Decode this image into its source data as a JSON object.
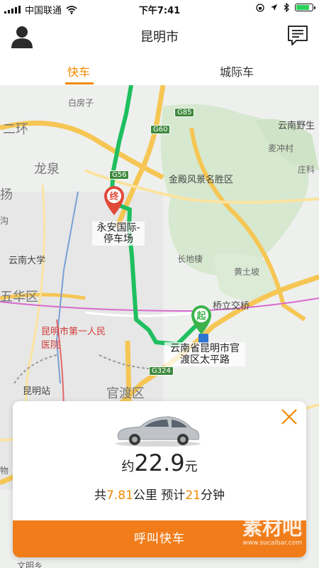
{
  "status_bar": {
    "carrier": "中国联通",
    "time": "下午7:41",
    "battery_level": 0.9,
    "icons": [
      "signal-icon",
      "wifi-icon",
      "lock-rotation-icon",
      "location-arrow-icon",
      "bluetooth-icon",
      "battery-icon"
    ]
  },
  "header": {
    "title": "昆明市",
    "left_icon": "user-avatar-icon",
    "right_icon": "message-icon"
  },
  "tabs": [
    {
      "label": "快车",
      "active": true
    },
    {
      "label": "城际车",
      "active": false
    }
  ],
  "map": {
    "labels": {
      "baifangzi": "白房子",
      "erhuan": "二环",
      "longquan": "龙泉",
      "yang": "扬",
      "gou": "沟",
      "yunnan_univ": "云南大学",
      "wuhua": "五华区",
      "hospital": "昆明市第一人民医院",
      "station": "昆明站",
      "guandu": "官渡区",
      "jindian": "金殿风景名胜区",
      "changdiying": "长地棲",
      "huangtupo": "黄土坡",
      "yunnan_wild": "云南野生",
      "maichongcun": "麦冲村",
      "zhuangke": "庄科",
      "interchange": "桥立交桥",
      "wu": "物",
      "wenming": "文明乡"
    },
    "shields": {
      "g85": "G85",
      "g60": "G60",
      "g56": "G56",
      "g324": "G324"
    },
    "destination": {
      "marker": "终",
      "name": "永安国际-停车场"
    },
    "origin": {
      "marker": "起",
      "name": "云南省昆明市官渡区太平路"
    }
  },
  "card": {
    "price_prefix": "约",
    "price": "22.9",
    "price_unit": "元",
    "trip_prefix": "共",
    "distance": "7.81",
    "distance_unit": "公里 预计",
    "duration": "21",
    "duration_unit": "分钟",
    "call_button": "呼叫快车",
    "close_icon": "close-icon"
  },
  "watermark": {
    "text": "素材吧",
    "url": "www.sucaibar.com"
  },
  "colors": {
    "accent": "#f08a00",
    "button": "#f07d1a",
    "route": "#1fbf60",
    "origin_marker": "#3cb34a",
    "destination_marker": "#e04a3a"
  }
}
